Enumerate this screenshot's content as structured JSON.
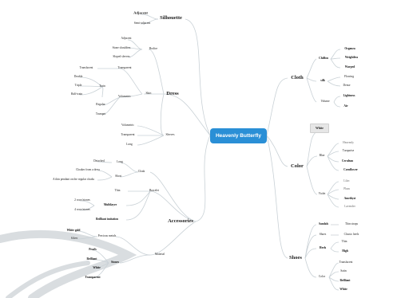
{
  "root": {
    "label": "Heavenly Butterfly"
  },
  "left": {
    "silhouette": {
      "label": "Silhouette",
      "children": [
        "Adjacent",
        "Semi-adjacent"
      ]
    },
    "dress": {
      "label": "Dress",
      "bodice": {
        "label": "Bodice",
        "children": [
          "Adjacent",
          "Stone shoulders",
          "Sloped sleeves"
        ]
      },
      "skirt": {
        "label": "Skirt",
        "transparent": {
          "label": "Transparent",
          "children": [
            "Translucent"
          ]
        },
        "volumetric": {
          "label": "Volumetric",
          "train_label": "Train",
          "train_children": [
            "Double",
            "Triple",
            "Half-train"
          ],
          "others": [
            "Regular",
            "Trumpet"
          ]
        }
      },
      "sleeves": {
        "label": "Sleeves",
        "children": [
          "Volumetric",
          "Transparent",
          "Long"
        ]
      }
    },
    "accessories": {
      "label": "Accessories",
      "cloak": {
        "label": "Cloak",
        "long": "Long",
        "long_children": [
          "Detached"
        ],
        "short": "Short",
        "short_children": [
          "Cloaker from a dress",
          "A thin pendant on the regular cloaks"
        ]
      },
      "bracelet": {
        "label": "Bracelet",
        "children": [
          "Thin"
        ],
        "multilayer": "Multilayer",
        "multilayer_children": [
          "2 rows/stones",
          "4 rows/stones"
        ],
        "brilliant": "Brilliant imitation"
      },
      "material": {
        "label": "Material",
        "precious": {
          "label": "Precious metals",
          "children": [
            "White gold",
            "Silver"
          ]
        },
        "stones": {
          "label": "Stones",
          "children": [
            "Pearls",
            "Brilliant",
            "White",
            "Transparent"
          ]
        }
      }
    }
  },
  "right": {
    "cloth": {
      "label": "Cloth",
      "chiffon": {
        "label": "Chiffon",
        "children": [
          "Organza",
          "Weightless",
          "Warped"
        ]
      },
      "silk": {
        "label": "silk",
        "children": [
          "Flowing",
          "Dense"
        ]
      },
      "volume": {
        "label": "Volume",
        "children": [
          "Lightness",
          "Air"
        ]
      }
    },
    "color": {
      "label": "Color",
      "white": "White",
      "blue": {
        "label": "Blue",
        "children": [
          "Heavenly",
          "Turquoise",
          "Cerulean",
          "Cornflower"
        ]
      },
      "violet": {
        "label": "Violet",
        "children": [
          "Lilac",
          "Plum",
          "Amethyst",
          "Lavender"
        ]
      }
    },
    "shoes": {
      "label": "Shoes",
      "sandals": {
        "label": "Sandals",
        "children": [
          "Thin straps"
        ]
      },
      "shoes": {
        "label": "Shoes",
        "children": [
          "Classic heels"
        ]
      },
      "heels": {
        "label": "Heels",
        "children": [
          "Thin",
          "High"
        ]
      },
      "color": {
        "label": "Color",
        "children": [
          "Translucent",
          "Satin",
          "Brilliant",
          "White"
        ]
      }
    }
  },
  "colors": {
    "root": "#2a8fd6",
    "branch": "#c9d1d6",
    "node_underline": "#b8c2c8",
    "watermark": "#d9dde0"
  }
}
